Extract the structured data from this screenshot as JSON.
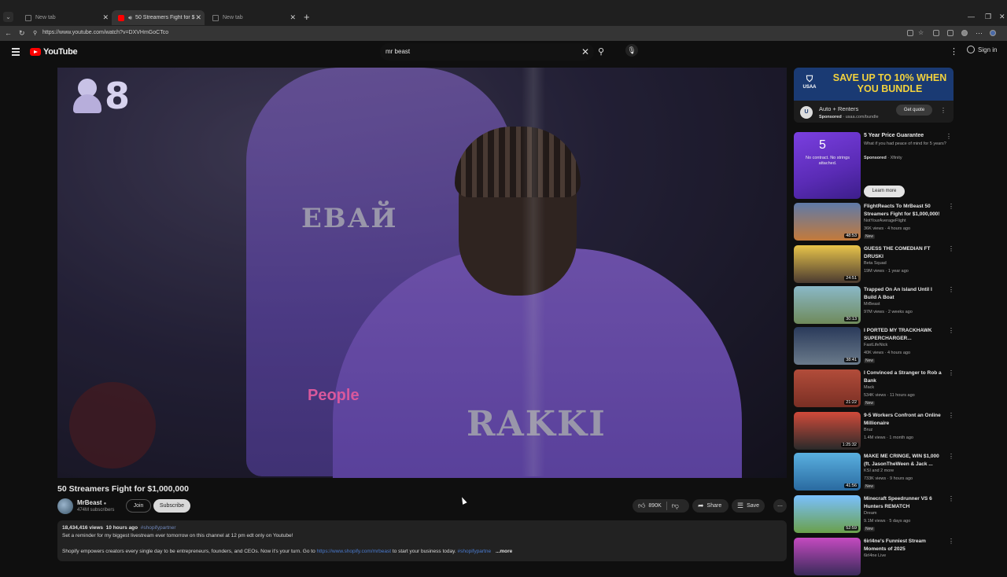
{
  "browser": {
    "tabs": [
      {
        "label": "New tab",
        "active": false
      },
      {
        "label": "50 Streamers Fight for $1,000,000",
        "active": true
      },
      {
        "label": "New tab",
        "active": false
      }
    ],
    "url": "https://www.youtube.com/watch?v=DXVHmGoCTco"
  },
  "header": {
    "logo": "YouTube",
    "search_value": "mr beast",
    "signin_label": "Sign in"
  },
  "player": {
    "overlay_number": "8",
    "caption": "People",
    "jersey_left": "ЕВАЙ",
    "jersey_main": "RAKKI"
  },
  "video": {
    "title": "50 Streamers Fight for $1,000,000",
    "channel": "MrBeast",
    "subscribers": "474M subscribers",
    "join_label": "Join",
    "subscribe_label": "Subscribe",
    "likes": "890K",
    "share_label": "Share",
    "save_label": "Save",
    "views": "18,434,416 views",
    "time_ago": "10 hours ago",
    "hashtag": "#shopifypartner",
    "desc_line1": "Set a reminder for my biggest livestream ever tomorrow on this channel at 12 pm edt only on Youtube!",
    "desc_line2_a": "Shopify empowers creators every single day to be entrepreneurs, founders, and CEOs. Now it's your turn. Go to",
    "desc_link": "https://www.shopify.com/mrbeast",
    "desc_line2_b": "to start your business today.",
    "desc_hashtag2": "#shopifypartne",
    "more_label": "...more"
  },
  "sidebar": {
    "ad1": {
      "logo_text": "USAA",
      "headline": "SAVE UP TO 10% WHEN YOU BUNDLE",
      "title": "Auto + Renters",
      "sponsored": "Sponsored",
      "domain": "usaa.com/bundle",
      "cta": "Get quote"
    },
    "ad2": {
      "thumb_big": "5",
      "thumb_text": "No contract. No strings attached.",
      "title": "5 Year Price Guarantee",
      "desc": "What if you had peace of mind for 5 years?",
      "sponsored": "Sponsored",
      "advertiser": "Xfinity",
      "cta": "Learn more"
    },
    "recs": [
      {
        "title": "FlightReacts To MrBeast 50 Streamers Fight for $1,000,000!",
        "channel": "NotYourAverageFlight",
        "stats": "36K views · 4 hours ago",
        "new": "New",
        "duration": "48:53",
        "thumb": "th-people"
      },
      {
        "title": "GUESS THE COMEDIAN FT DRUSKI",
        "channel": "Beta Squad",
        "stats": "19M views · 1 year ago",
        "new": "",
        "duration": "24:51",
        "thumb": "th-comedian"
      },
      {
        "title": "Trapped On An Island Until I Build A Boat",
        "channel": "MrBeast",
        "stats": "97M views · 2 weeks ago",
        "new": "",
        "duration": "30:13",
        "thumb": "th-island"
      },
      {
        "title": "I PORTED MY TRACKHAWK SUPERCHARGER...",
        "channel": "FastLifeNick",
        "stats": "40K views · 4 hours ago",
        "new": "New",
        "duration": "38:41",
        "thumb": "th-truck"
      },
      {
        "title": "I Convinced a Stranger to Rob a Bank",
        "channel": "Mack",
        "stats": "534K views · 11 hours ago",
        "new": "New",
        "duration": "21:22",
        "thumb": "th-rob"
      },
      {
        "title": "9-5 Workers Confront an Online Millionaire",
        "channel": "Bruz",
        "stats": "1.4M views · 1 month ago",
        "new": "",
        "duration": "1:25:32",
        "thumb": "th-workers"
      },
      {
        "title": "MAKE ME CRINGE, WIN $1,000 (ft. JasonTheWeen & Jack ...",
        "channel": "KSI and 2 more",
        "stats": "733K views · 9 hours ago",
        "new": "New",
        "duration": "41:56",
        "thumb": "th-cringe"
      },
      {
        "title": "Minecraft Speedrunner VS 6 Hunters REMATCH",
        "channel": "Dream",
        "stats": "9.1M views · 5 days ago",
        "new": "New",
        "duration": "52:59",
        "thumb": "th-mine"
      },
      {
        "title": "6irl4ne's Funniest Stream Moments of 2025",
        "channel": "6irl4ne Live",
        "stats": "",
        "new": "",
        "duration": "",
        "thumb": "th-girl"
      }
    ]
  }
}
